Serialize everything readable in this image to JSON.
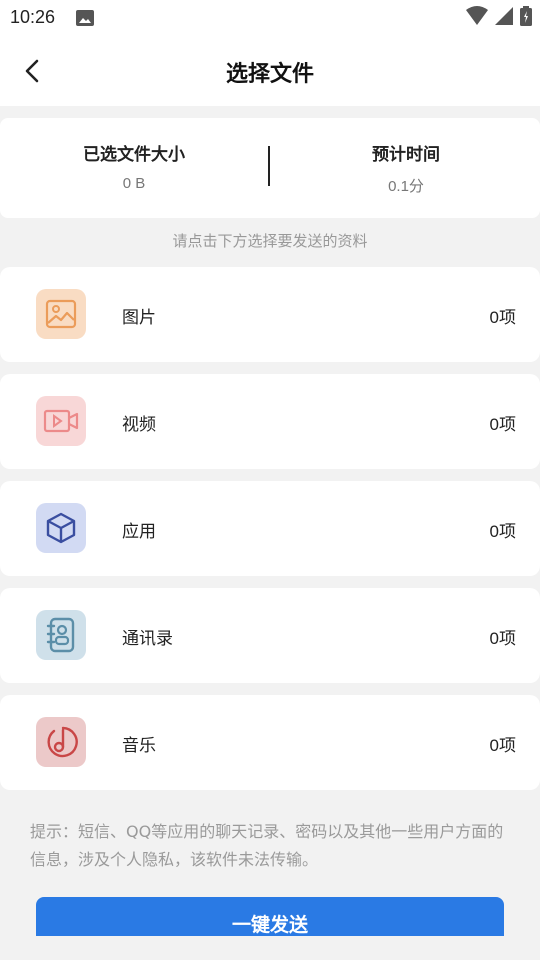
{
  "status_bar": {
    "time": "10:26"
  },
  "header": {
    "title": "选择文件"
  },
  "summary": {
    "selected_size_label": "已选文件大小",
    "selected_size_value": "0 B",
    "estimated_time_label": "预计时间",
    "estimated_time_value": "0.1分"
  },
  "hint": "请点击下方选择要发送的资料",
  "file_types": [
    {
      "name": "图片",
      "count": "0项",
      "icon": "image-icon",
      "bg": "#f9dcc3",
      "fg": "#eb9c5a"
    },
    {
      "name": "视频",
      "count": "0项",
      "icon": "video-icon",
      "bg": "#f8d7d7",
      "fg": "#ec8a8a"
    },
    {
      "name": "应用",
      "count": "0项",
      "icon": "app-cube-icon",
      "bg": "#d2daf3",
      "fg": "#3a4ea0"
    },
    {
      "name": "通讯录",
      "count": "0项",
      "icon": "contacts-icon",
      "bg": "#cfe0ea",
      "fg": "#5b8ea8"
    },
    {
      "name": "音乐",
      "count": "0项",
      "icon": "music-icon",
      "bg": "#ecc9c9",
      "fg": "#c94747"
    }
  ],
  "tip": "提示：短信、QQ等应用的聊天记录、密码以及其他一些用户方面的信息，涉及个人隐私，该软件未法传输。",
  "send_button": {
    "label": "一键发送",
    "color": "#2a7ae4"
  }
}
